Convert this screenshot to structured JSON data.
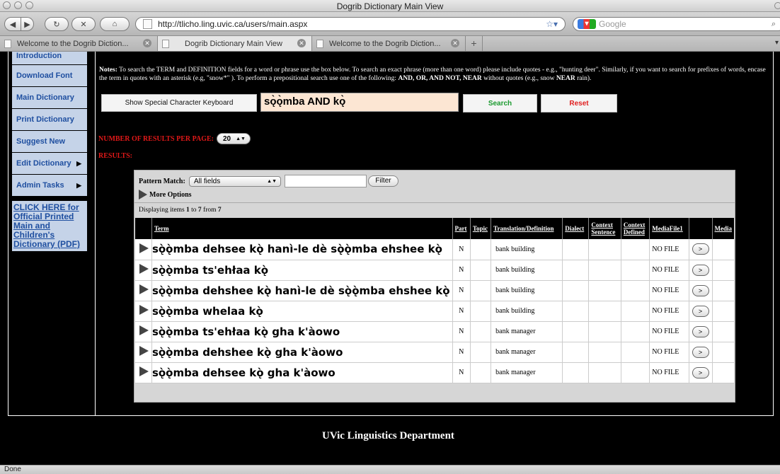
{
  "window": {
    "title": "Dogrib Dictionary Main View"
  },
  "browser": {
    "url": "http://tlicho.ling.uvic.ca/users/main.aspx",
    "search_placeholder": "Google",
    "tabs": [
      {
        "label": "Welcome to the Dogrib Diction..."
      },
      {
        "label": "Dogrib Dictionary Main View"
      },
      {
        "label": "Welcome to the Dogrib Diction..."
      }
    ]
  },
  "sidebar": {
    "items": [
      {
        "label": "Introduction"
      },
      {
        "label": "Download Font"
      },
      {
        "label": "Main Dictionary"
      },
      {
        "label": "Print Dictionary"
      },
      {
        "label": "Suggest New"
      },
      {
        "label": "Edit Dictionary"
      },
      {
        "label": "Admin Tasks"
      }
    ],
    "click_here": "CLICK HERE for Official Printed Main and Children's Dictionary (PDF)"
  },
  "notes": {
    "label": "Notes:",
    "text1": "To search the TERM and DEFINITION fields for a word or phrase use the box below. To search an exact phrase (more than one word) please include quotes - e.g., \"hunting deer\". Similarly, if you want to search for prefixes of words, encase the term in quotes with an asterisk (e.g, \"snow*\" ). To perform a prepositional search use one of the following: ",
    "operators": "AND, OR, AND NOT, NEAR",
    "text2": " without quotes (e.g., snow ",
    "near": "NEAR",
    "text3": " rain)."
  },
  "search": {
    "keyboard_button": "Show Special Character Keyboard",
    "query": "sǫ̀ǫ̀mba AND kǫ̀",
    "search_button": "Search",
    "reset_button": "Reset"
  },
  "results": {
    "per_page_label": "NUMBER OF RESULTS PER PAGE:",
    "per_page_value": "20",
    "results_label": "RESULTS:"
  },
  "grid": {
    "pattern_match_label": "Pattern Match:",
    "pattern_match_value": "All fields",
    "filter_button": "Filter",
    "more_options": "More Options",
    "displaying_prefix": "Displaying items ",
    "displaying_from": "1",
    "displaying_to_word": " to ",
    "displaying_to": "7",
    "displaying_from_word": " from ",
    "displaying_total": "7",
    "columns": [
      "Term",
      "Part",
      "Topic",
      "Translation/Definition",
      "Dialect",
      "Context Sentence",
      "Context Defined",
      "MediaFile1",
      "",
      "Media"
    ],
    "rows": [
      {
        "term": "sǫ̀ǫ̀mba dehsee kǫ̀ hanì-le dè sǫ̀ǫ̀mba ehshee kǫ̀",
        "part": "N",
        "definition": "bank building",
        "media": "NO FILE",
        "play": ">"
      },
      {
        "term": "sǫ̀ǫ̀mba ts'ehłaa kǫ̀",
        "part": "N",
        "definition": "bank building",
        "media": "NO FILE",
        "play": ">"
      },
      {
        "term": "sǫ̀ǫ̀mba dehshee kǫ̀ hanì-le dè sǫ̀ǫ̀mba ehshee kǫ̀",
        "part": "N",
        "definition": "bank building",
        "media": "NO FILE",
        "play": ">"
      },
      {
        "term": "sǫ̀ǫ̀mba whelaa kǫ̀",
        "part": "N",
        "definition": "bank building",
        "media": "NO FILE",
        "play": ">"
      },
      {
        "term": "sǫ̀ǫ̀mba ts'ehłaa kǫ̀ gha k'àowo",
        "part": "N",
        "definition": "bank manager",
        "media": "NO FILE",
        "play": ">"
      },
      {
        "term": "sǫ̀ǫ̀mba dehshee kǫ̀ gha k'àowo",
        "part": "N",
        "definition": "bank manager",
        "media": "NO FILE",
        "play": ">"
      },
      {
        "term": "sǫ̀ǫ̀mba dehsee kǫ̀ gha k'àowo",
        "part": "N",
        "definition": "bank manager",
        "media": "NO FILE",
        "play": ">"
      }
    ]
  },
  "footer": {
    "text": "UVic Linguistics Department"
  },
  "status": {
    "text": "Done"
  }
}
